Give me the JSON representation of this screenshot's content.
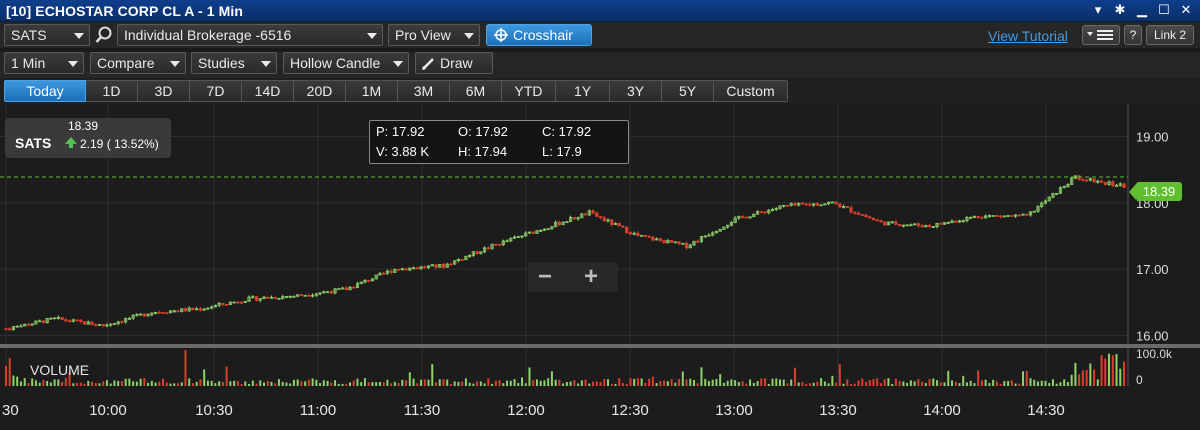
{
  "window": {
    "title": "[10] ECHOSTAR CORP CL A - 1 Min",
    "controls": [
      "▾",
      "✱",
      "▁",
      "☐",
      "✕"
    ]
  },
  "toolbar1": {
    "symbol": "SATS",
    "account": "Individual Brokerage -6516",
    "view": "Pro View",
    "crosshair": "Crosshair",
    "view_tutorial": "View Tutorial",
    "help": "?",
    "link": "Link 2"
  },
  "toolbar2": {
    "interval": "1 Min",
    "compare": "Compare",
    "studies": "Studies",
    "chart_type": "Hollow Candle",
    "draw": "Draw"
  },
  "ranges": [
    {
      "label": "Today",
      "active": true
    },
    {
      "label": "1D"
    },
    {
      "label": "3D"
    },
    {
      "label": "7D"
    },
    {
      "label": "14D"
    },
    {
      "label": "20D"
    },
    {
      "label": "1M"
    },
    {
      "label": "3M"
    },
    {
      "label": "6M"
    },
    {
      "label": "YTD"
    },
    {
      "label": "1Y"
    },
    {
      "label": "3Y"
    },
    {
      "label": "5Y"
    },
    {
      "label": "Custom"
    }
  ],
  "quote": {
    "price": "18.39",
    "symbol": "SATS",
    "change": "2.19 ( 13.52%)",
    "up_color": "#4fc34f"
  },
  "ohlc": {
    "p": "P: 17.92",
    "o": "O: 17.92",
    "c": "C: 17.92",
    "v": "V: 3.88 K",
    "h": "H: 17.94",
    "l": "L: 17.9"
  },
  "last_price_tag": "18.39",
  "zoom": {
    "minus": "−",
    "plus": "+"
  },
  "volume_label": "VOLUME",
  "colors": {
    "up": "#8fd16a",
    "down": "#d8402c",
    "accent": "#3d98e0",
    "last_line": "#5fbf2f"
  },
  "chart_data": {
    "type": "candlestick",
    "title": "",
    "x_ticks": [
      "30",
      "10:00",
      "10:30",
      "11:00",
      "11:30",
      "12:00",
      "12:30",
      "13:00",
      "13:30",
      "14:00",
      "14:30"
    ],
    "y_ticks": [
      "19.00",
      "18.00",
      "17.00",
      "16.00"
    ],
    "ylim": [
      15.9,
      19.4
    ],
    "volume_ticks": [
      "100.0k",
      "0"
    ],
    "last_price": 18.39,
    "series": [
      {
        "name": "Price",
        "x": [
          "09:30",
          "09:45",
          "10:00",
          "10:15",
          "10:30",
          "10:45",
          "11:00",
          "11:15",
          "11:30",
          "11:45",
          "12:00",
          "12:15",
          "12:30",
          "12:45",
          "13:00",
          "13:15",
          "13:30",
          "13:45",
          "14:00",
          "14:15",
          "14:30",
          "14:40",
          "14:45",
          "14:50"
        ],
        "values": [
          16.1,
          16.25,
          16.15,
          16.35,
          16.4,
          16.55,
          16.6,
          16.7,
          17.0,
          17.05,
          17.35,
          17.6,
          17.85,
          17.5,
          17.35,
          17.75,
          17.95,
          18.0,
          17.7,
          17.65,
          17.8,
          17.8,
          18.39,
          18.25
        ]
      }
    ]
  }
}
